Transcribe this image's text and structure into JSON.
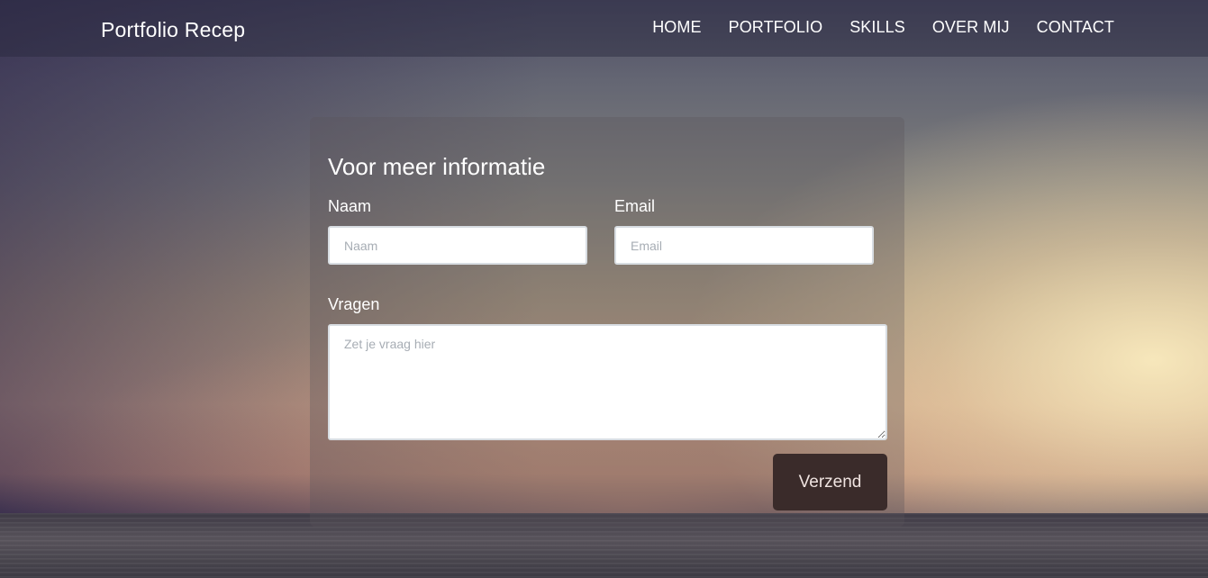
{
  "navbar": {
    "brand": "Portfolio Recep",
    "links": [
      "HOME",
      "PORTFOLIO",
      "SKILLS",
      "OVER MIJ",
      "CONTACT"
    ]
  },
  "form": {
    "title": "Voor meer informatie",
    "name_label": "Naam",
    "name_placeholder": "Naam",
    "name_value": "",
    "email_label": "Email",
    "email_placeholder": "Email",
    "email_value": "",
    "questions_label": "Vragen",
    "questions_placeholder": "Zet je vraag hier",
    "questions_value": "",
    "submit_label": "Verzend"
  },
  "colors": {
    "navbar_text": "#ffffff",
    "button_bg": "#3a2b2a",
    "button_text": "#efe3e0",
    "input_border": "#d8dde2",
    "placeholder": "#a7adb4"
  }
}
